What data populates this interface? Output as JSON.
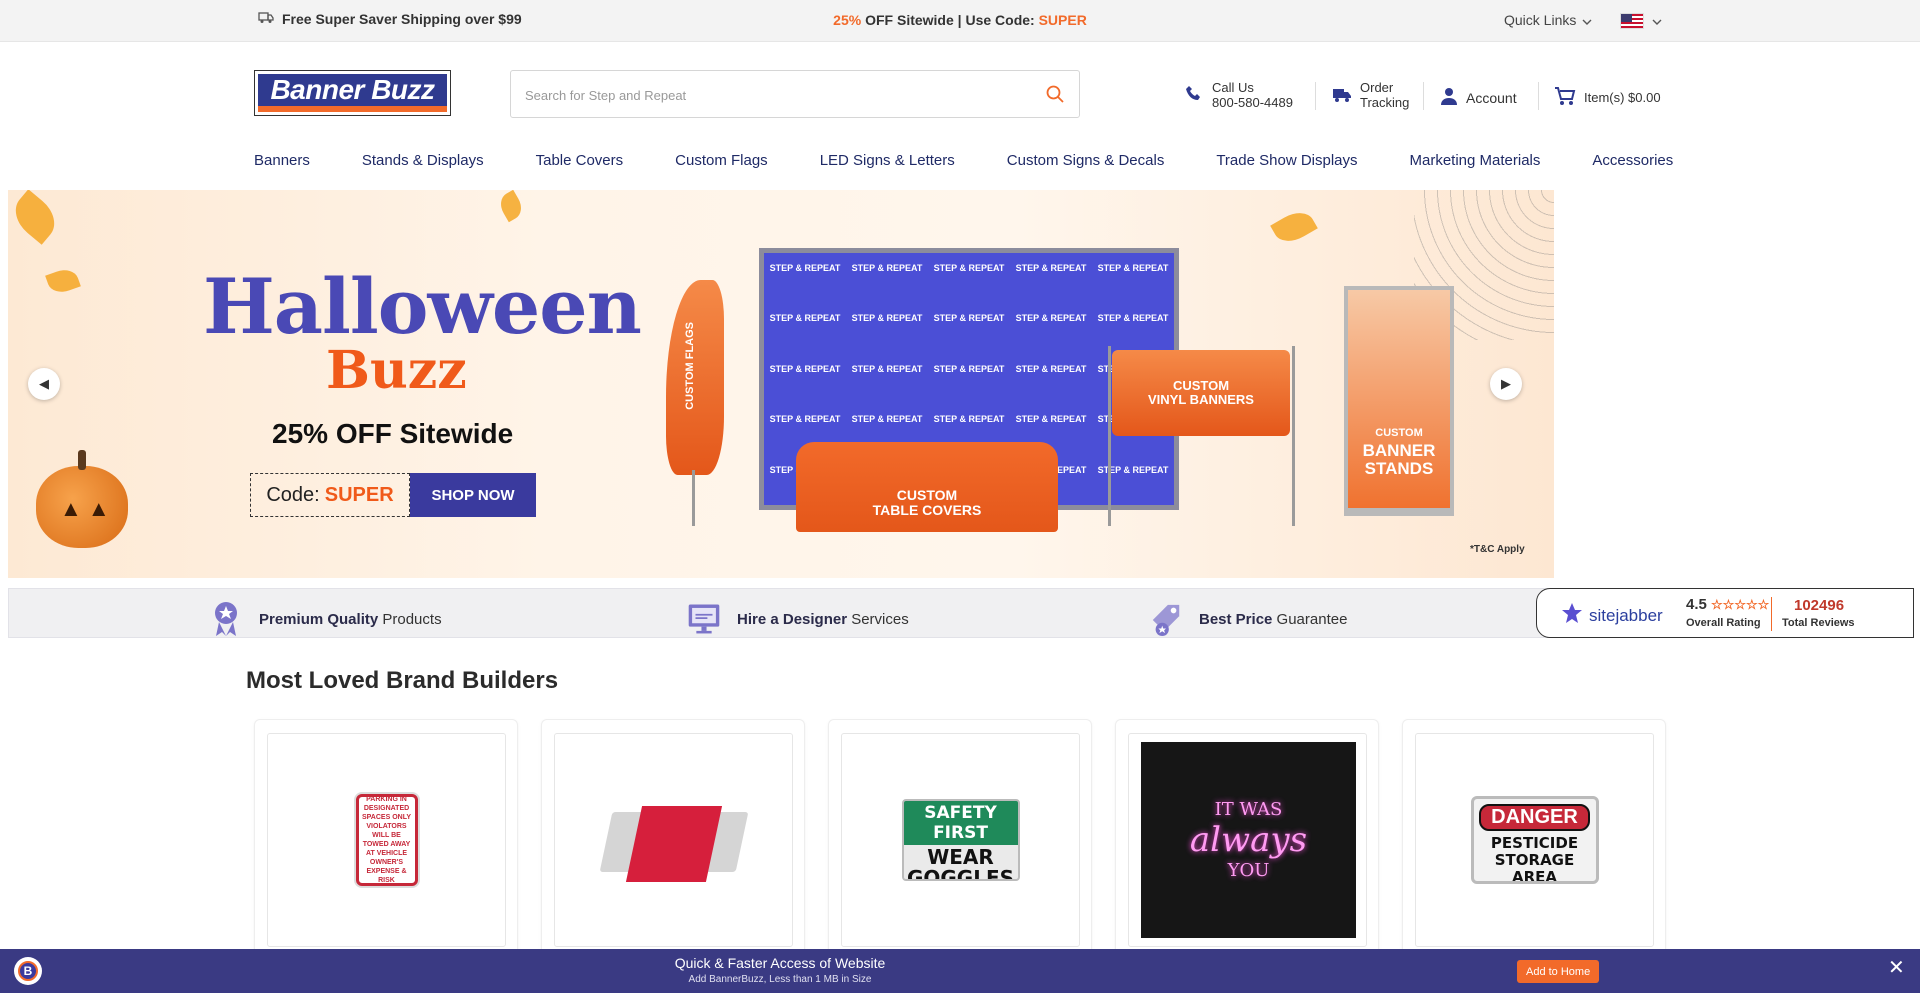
{
  "topbar": {
    "shipping": "Free Super Saver Shipping over $99",
    "promo_percent": "25%",
    "promo_text": " OFF Sitewide | Use Code: ",
    "promo_code": "SUPER",
    "quick_links": "Quick Links"
  },
  "header": {
    "logo": "Banner Buzz",
    "search_placeholder": "Search for Step and Repeat",
    "call_label": "Call Us",
    "call_number": "800-580-4489",
    "order_label_1": "Order",
    "order_label_2": "Tracking",
    "account": "Account",
    "cart": "Item(s) $0.00"
  },
  "nav": [
    "Banners",
    "Stands & Displays",
    "Table Covers",
    "Custom Flags",
    "LED Signs & Letters",
    "Custom Signs & Decals",
    "Trade Show Displays",
    "Marketing Materials",
    "Accessories"
  ],
  "hero": {
    "title": "Halloween",
    "subtitle": "Buzz",
    "offer": "25% OFF Sitewide",
    "code_label": "Code:",
    "code": "SUPER",
    "cta": "SHOP NOW",
    "feather_text": "CUSTOM FLAGS",
    "backdrop_text": "STEP & REPEAT",
    "table_text_1": "CUSTOM",
    "table_text_2": "TABLE COVERS",
    "banner_text_1": "CUSTOM",
    "banner_text_2": "VINYL BANNERS",
    "stand_text_1": "CUSTOM",
    "stand_text_2": "BANNER STANDS",
    "terms": "*T&C Apply"
  },
  "features": {
    "f1_bold": "Premium Quality",
    "f1_rest": " Products",
    "f2_bold": "Hire a Designer",
    "f2_rest": " Services",
    "f3_bold": "Best Price",
    "f3_rest": " Guarantee",
    "sitejabber": "sitejabber",
    "rating": "4.5",
    "rating_label": "Overall Rating",
    "reviews": "102496",
    "reviews_label": "Total Reviews"
  },
  "section": {
    "title": "Most Loved Brand Builders"
  },
  "products": {
    "p1": "PARKING IN DESIGNATED SPACES ONLY VIOLATORS WILL BE TOWED AWAY AT VEHICLE OWNER'S EXPENSE & RISK",
    "p3_top": "SAFETY FIRST",
    "p3_bottom": "WEAR GOGGLES",
    "p4_1": "IT WAS",
    "p4_2": "always",
    "p4_3": "YOU",
    "p5_top": "DANGER",
    "p5_bottom": "PESTICIDE STORAGE AREA"
  },
  "pwa": {
    "title": "Quick & Faster Access of Website",
    "subtitle": "Add BannerBuzz, Less than 1 MB in Size",
    "button": "Add to Home"
  },
  "colors": {
    "accent": "#f26a2a",
    "brand": "#3a3a9e",
    "nav_text": "#1f2a66"
  }
}
